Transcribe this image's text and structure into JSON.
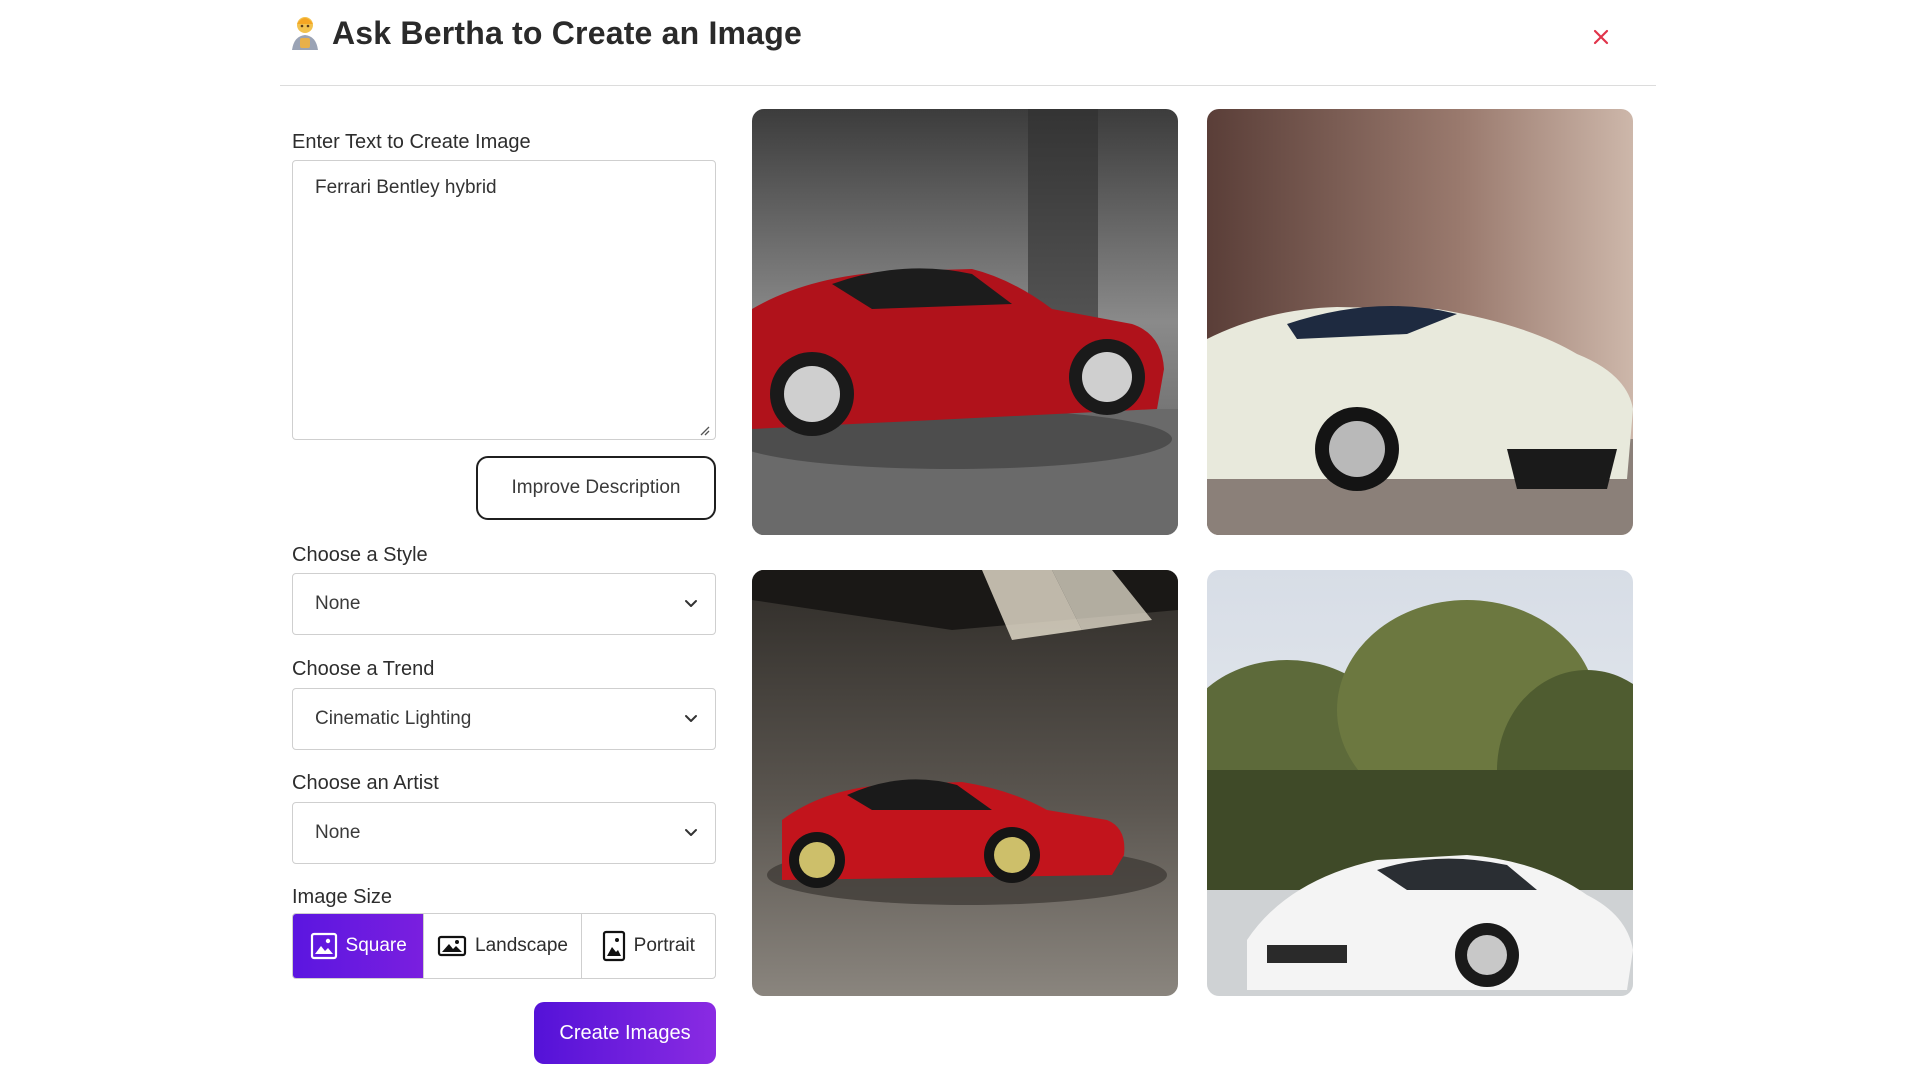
{
  "dialog": {
    "title": "Ask Bertha to Create an Image",
    "title_icon": "genie-icon",
    "close_icon": "close-icon",
    "accent": "#6a1be0",
    "close_color": "#e0344a"
  },
  "form": {
    "prompt_label": "Enter Text to Create Image",
    "prompt_value": "Ferrari Bentley hybrid",
    "improve_button": "Improve Description",
    "style": {
      "label": "Choose a Style",
      "selected": "None"
    },
    "trend": {
      "label": "Choose a Trend",
      "selected": "Cinematic Lighting"
    },
    "artist": {
      "label": "Choose an Artist",
      "selected": "None"
    },
    "size": {
      "label": "Image Size",
      "options": [
        "Square",
        "Landscape",
        "Portrait"
      ],
      "selected": "Square"
    },
    "create_button": "Create Images"
  },
  "results": {
    "images": [
      {
        "subject": "red sports car in grey studio",
        "icon": "generated-image"
      },
      {
        "subject": "white sports car front view",
        "icon": "generated-image"
      },
      {
        "subject": "red sports car under spotlights",
        "icon": "generated-image"
      },
      {
        "subject": "white sports car by trees",
        "icon": "generated-image"
      }
    ]
  }
}
